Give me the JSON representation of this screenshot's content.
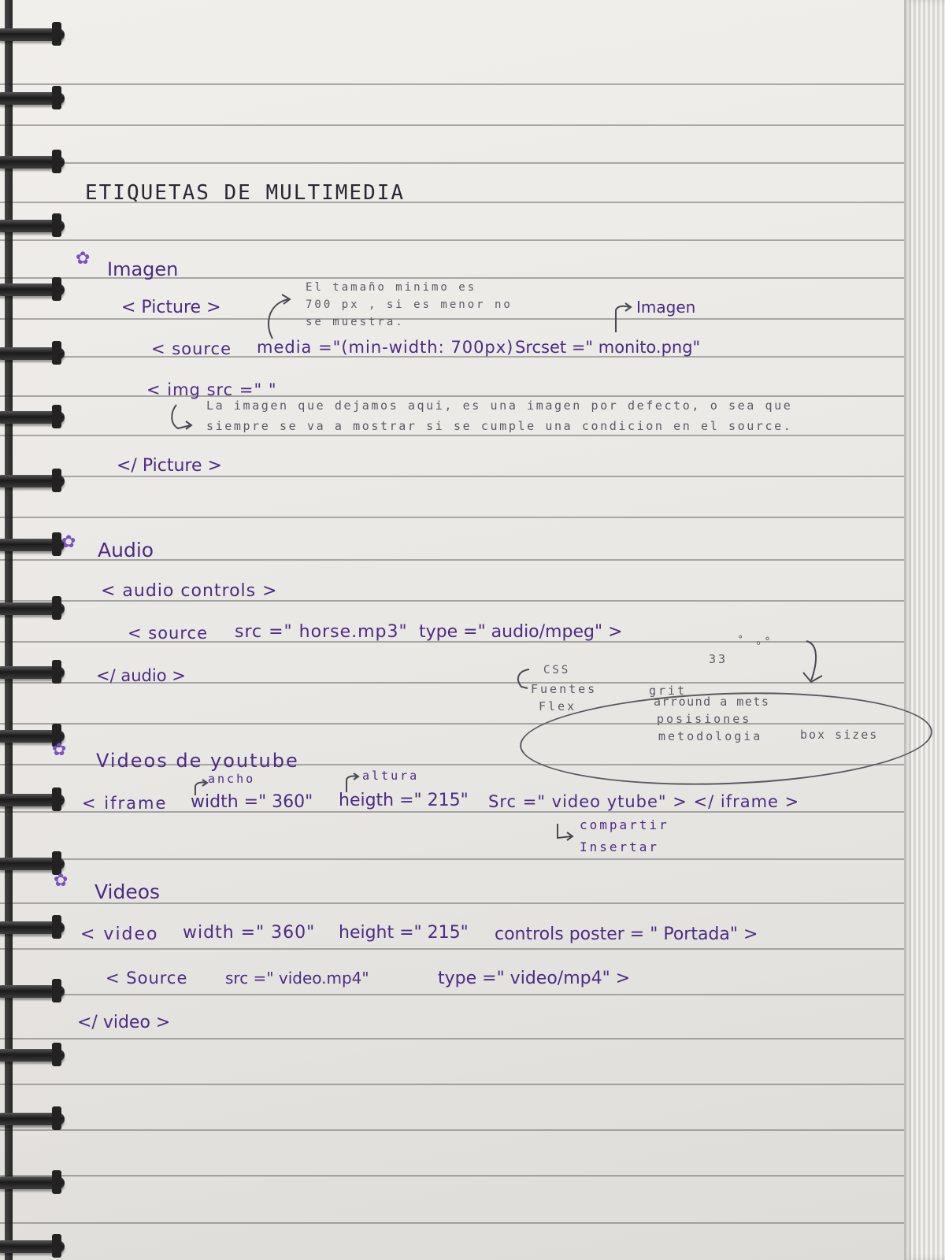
{
  "title": "ETIQUETAS DE MULTIMEDIA",
  "sections": {
    "imagen": {
      "heading": "Imagen",
      "picture_open": "< Picture >",
      "note_lines": [
        "El tamaño minimo es",
        "700 px , si es menor no",
        "se muestra."
      ],
      "label_imagen": "Imagen",
      "source_line": {
        "tag": "< source",
        "media": "media =\"(min-width: 700px)",
        "srcset": "Srcset =\" monito.png\""
      },
      "img_tag": "< img  src =\" \"",
      "img_note_lines": [
        "La imagen que dejamos aqui, es una imagen por defecto, o sea que",
        "siempre se va a mostrar si se cumple una condicion en el source."
      ],
      "picture_close": "</ Picture >"
    },
    "audio": {
      "heading": "Audio",
      "open_tag": "< audio  controls >",
      "source": {
        "tag": "< source",
        "src": "src =\" horse.mp3\"",
        "type": "type =\" audio/mpeg\" >"
      },
      "close_tag": "</ audio >"
    },
    "side_notes": {
      "css": "CSS",
      "fuentes": "Fuentes",
      "flex": "Flex",
      "number": "33",
      "grit": "grit",
      "arround": "arround a mets",
      "posisiones": "posisiones",
      "metodologia": "metodologia",
      "box_sizes": "box sizes"
    },
    "youtube": {
      "heading": "Videos de youtube",
      "label_ancho": "ancho",
      "label_altura": "altura",
      "iframe_tag": "< iframe",
      "width_attr": "width =\" 360\"",
      "height_attr": "heigth =\" 215\"",
      "src_attr": "Src =\" video ytube\" > </ iframe >",
      "compartir": "compartir",
      "insertar": "Insertar"
    },
    "videos": {
      "heading": "Videos",
      "open_tag": "< video",
      "width_attr": "width =\" 360\"",
      "height_attr": "height =\" 215\"",
      "controls_poster": "controls  poster = \" Portada\" >",
      "source": {
        "tag": "< Source",
        "src": "src =\" video.mp4\"",
        "type": "type =\" video/mp4\" >"
      },
      "close_tag": "</ video >"
    }
  },
  "colors": {
    "ink_black": "#2a2833",
    "ink_purple": "#4b2b86",
    "flower": "#7a52c4"
  },
  "icons": [
    "flower-icon",
    "arrow-icon"
  ]
}
